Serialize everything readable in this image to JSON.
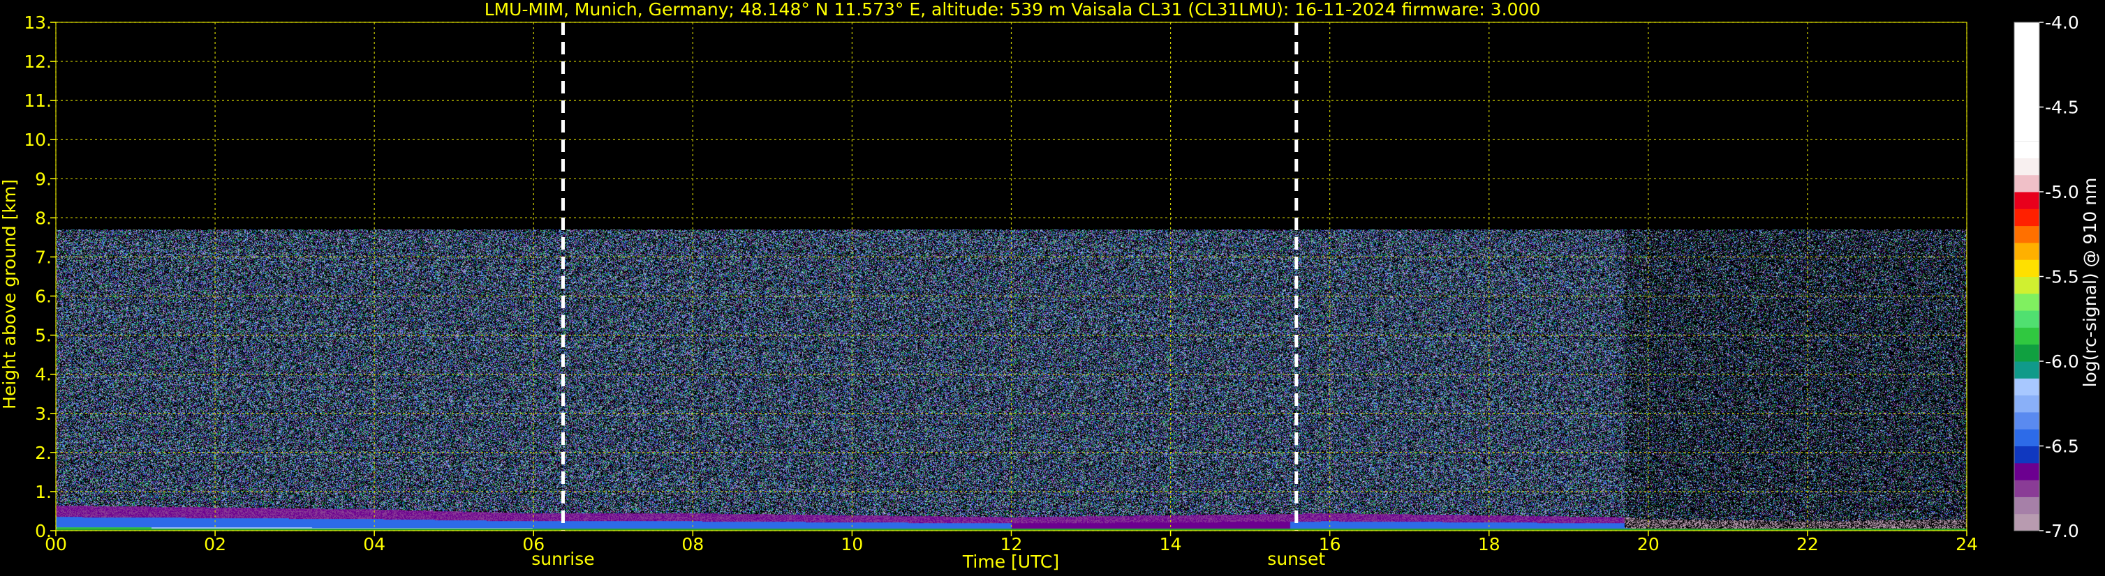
{
  "chart_data": {
    "type": "heatmap",
    "title": "LMU-MIM, Munich, Germany; 48.148° N 11.573° E, altitude: 539 m    Vaisala CL31 (CL31LMU): 16-11-2024    firmware: 3.000",
    "xlabel": "Time [UTC]",
    "ylabel": "Height above ground [km]",
    "xlim": [
      0,
      24
    ],
    "ylim": [
      0,
      13
    ],
    "x_ticks": [
      "00",
      "02",
      "04",
      "06",
      "08",
      "10",
      "12",
      "14",
      "16",
      "18",
      "20",
      "22",
      "24"
    ],
    "y_ticks": [
      "0.",
      "1.",
      "2.",
      "3.",
      "4.",
      "5.",
      "6.",
      "7.",
      "8.",
      "9.",
      "10.",
      "11.",
      "12.",
      "13."
    ],
    "grid": true,
    "noise_top_km": 7.7,
    "markers": [
      {
        "label": "sunrise",
        "time_h": 6.37
      },
      {
        "label": "sunset",
        "time_h": 15.58
      }
    ],
    "boundary_layer": {
      "times_h": [
        0,
        2,
        4,
        6,
        8,
        10,
        12,
        14,
        16,
        18,
        19.7,
        20,
        22,
        24
      ],
      "top_km": [
        0.65,
        0.6,
        0.55,
        0.45,
        0.45,
        0.4,
        0.35,
        0.4,
        0.45,
        0.4,
        0.35,
        0.3,
        0.25,
        0.3
      ]
    },
    "colorbar": {
      "label": "log(rc-signal) @ 910 nm",
      "range": [
        -7.0,
        -4.0
      ],
      "ticks": [
        "-4.0",
        "-4.5",
        "-5.0",
        "-5.5",
        "-6.0",
        "-6.5",
        "-7.0"
      ],
      "colors": [
        "#b89bb0",
        "#a680a8",
        "#8a3c96",
        "#6c0090",
        "#1038c0",
        "#2d6be8",
        "#5a8af0",
        "#8ab0f8",
        "#a8c8ff",
        "#109a8a",
        "#10a040",
        "#30c840",
        "#50e070",
        "#80f060",
        "#d0f030",
        "#ffe000",
        "#ffb000",
        "#ff7000",
        "#ff2000",
        "#e8001c",
        "#f0c0c8",
        "#f8f0f0",
        "#ffffff"
      ]
    }
  },
  "colors": {
    "text": "#ffff00",
    "grid": "#cccc00",
    "background": "#000000",
    "marker": "#ffffff"
  }
}
